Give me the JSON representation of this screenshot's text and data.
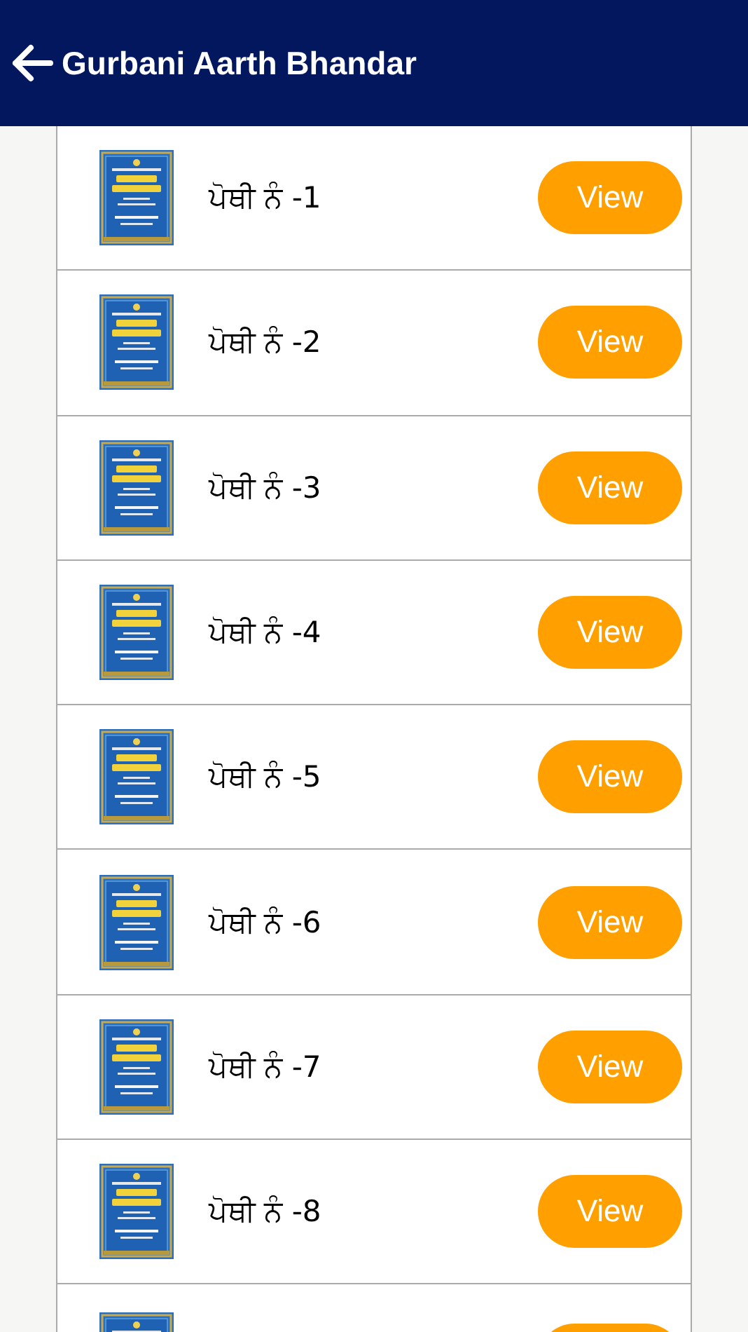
{
  "header": {
    "title": "Gurbani Aarth Bhandar"
  },
  "books": [
    {
      "kind": "book",
      "label": "ਪੋਥੀ ਨੰ -1",
      "button": "View"
    },
    {
      "kind": "book",
      "label": "ਪੋਥੀ ਨੰ -2",
      "button": "View"
    },
    {
      "kind": "book",
      "label": "ਪੋਥੀ ਨੰ -3",
      "button": "View"
    },
    {
      "kind": "book",
      "label": "ਪੋਥੀ ਨੰ -4",
      "button": "View"
    },
    {
      "kind": "book",
      "label": "ਪੋਥੀ ਨੰ -5",
      "button": "View"
    },
    {
      "kind": "book",
      "label": "ਪੋਥੀ ਨੰ -6",
      "button": "View"
    },
    {
      "kind": "book",
      "label": "ਪੋਥੀ ਨੰ -7",
      "button": "View"
    },
    {
      "kind": "book",
      "label": "ਪੋਥੀ ਨੰ -8",
      "button": "View"
    },
    {
      "kind": "cut"
    }
  ]
}
